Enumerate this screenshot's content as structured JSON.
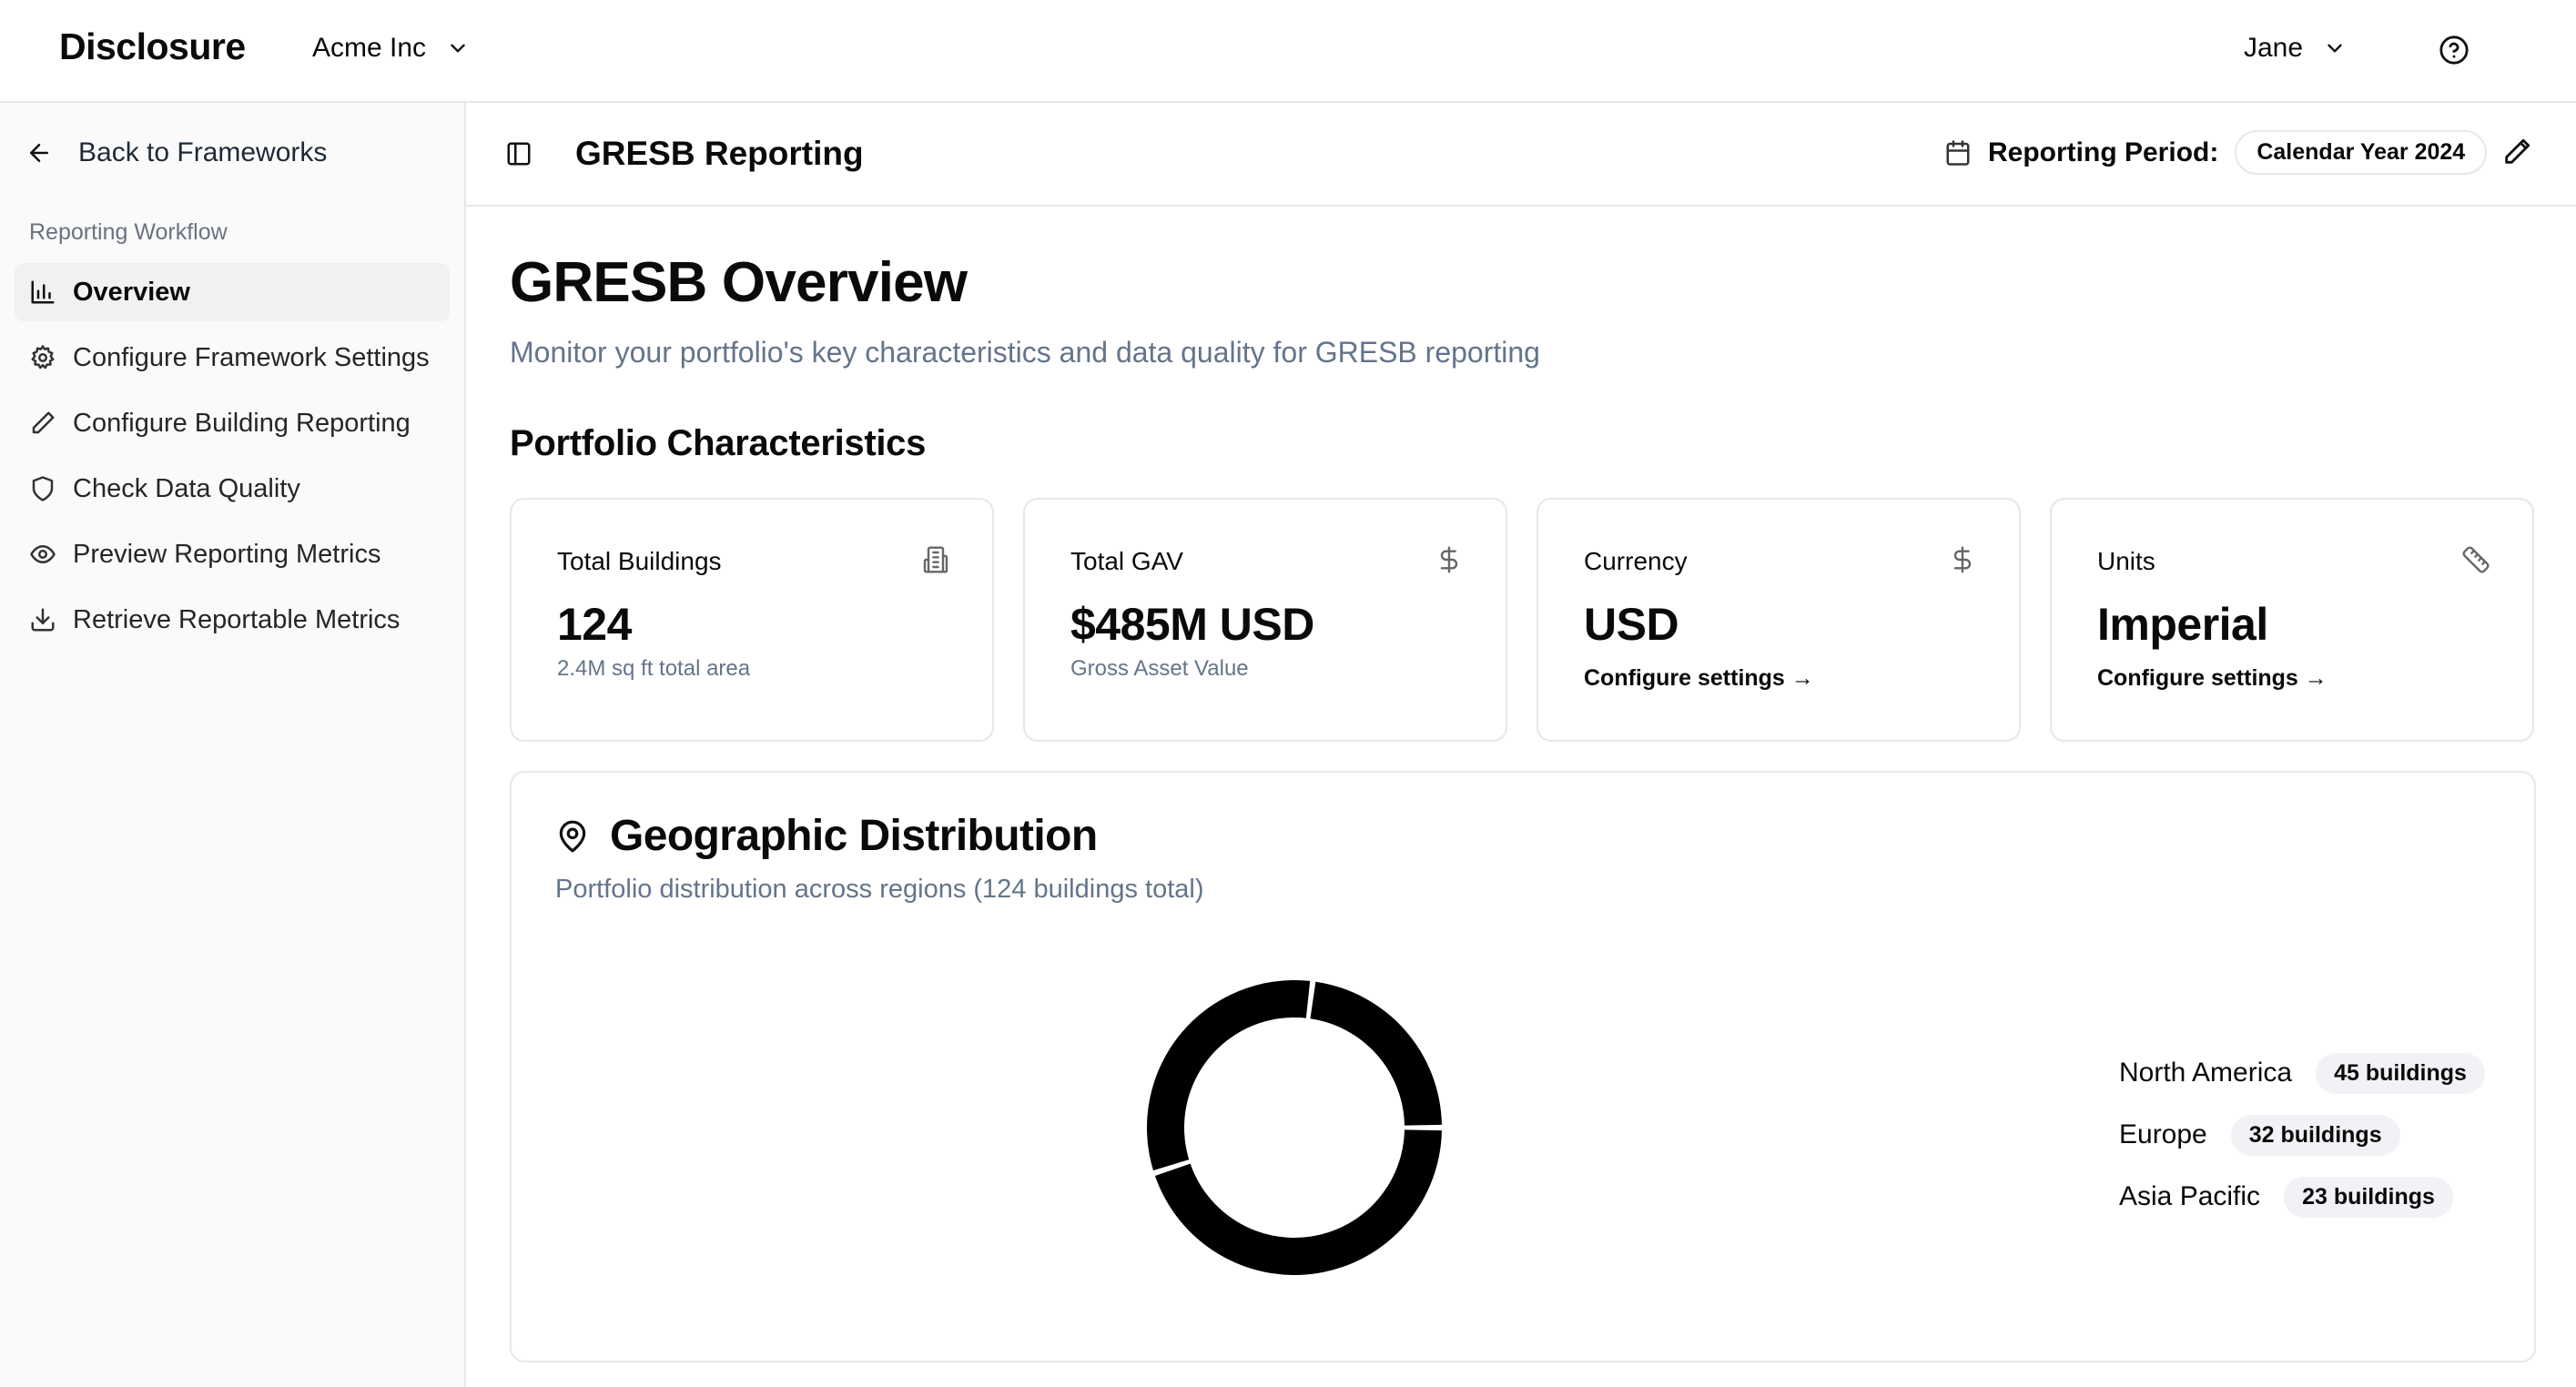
{
  "app": {
    "brand": "Disclosure",
    "org": "Acme Inc",
    "user": "Jane"
  },
  "sidebar": {
    "back_label": "Back to Frameworks",
    "section": "Reporting Workflow",
    "items": [
      {
        "label": "Overview",
        "icon": "bar-chart-icon",
        "active": true
      },
      {
        "label": "Configure Framework Settings",
        "icon": "gear-icon",
        "active": false
      },
      {
        "label": "Configure Building Reporting",
        "icon": "pencil-icon",
        "active": false
      },
      {
        "label": "Check Data Quality",
        "icon": "shield-icon",
        "active": false
      },
      {
        "label": "Preview Reporting Metrics",
        "icon": "eye-icon",
        "active": false
      },
      {
        "label": "Retrieve Reportable Metrics",
        "icon": "download-icon",
        "active": false
      }
    ]
  },
  "header": {
    "title": "GRESB Reporting",
    "period_label": "Reporting Period:",
    "period_value": "Calendar Year 2024"
  },
  "main": {
    "title": "GRESB Overview",
    "subtitle": "Monitor your portfolio's key characteristics and data quality for GRESB reporting",
    "section_title": "Portfolio Characteristics",
    "cards": [
      {
        "label": "Total Buildings",
        "value": "124",
        "sub": "2.4M sq ft total area",
        "icon": "building-icon"
      },
      {
        "label": "Total GAV",
        "value": "$485M USD",
        "sub": "Gross Asset Value",
        "icon": "dollar-icon"
      },
      {
        "label": "Currency",
        "value": "USD",
        "link": "Configure settings →",
        "icon": "dollar-icon"
      },
      {
        "label": "Units",
        "value": "Imperial",
        "link": "Configure settings →",
        "icon": "ruler-icon"
      }
    ],
    "geo": {
      "title": "Geographic Distribution",
      "subtitle": "Portfolio distribution across regions (124 buildings total)"
    }
  },
  "chart_data": {
    "type": "pie",
    "categories": [
      "North America",
      "Europe",
      "Asia Pacific"
    ],
    "values": [
      45,
      32,
      23
    ],
    "value_labels": [
      "45 buildings",
      "32 buildings",
      "23 buildings"
    ],
    "colors": [
      "#000000",
      "#000000",
      "#000000"
    ],
    "legend_position": "right"
  }
}
